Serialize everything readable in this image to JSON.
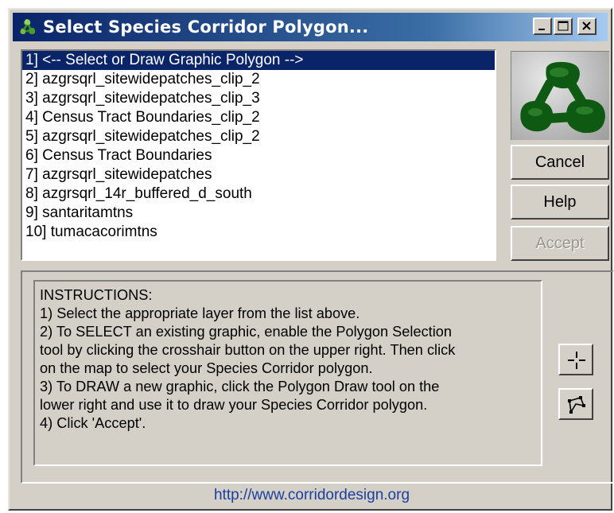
{
  "window": {
    "title": "Select Species Corridor Polygon...",
    "title_icon": "corridor-app-icon",
    "controls": [
      "minimize-icon",
      "maximize-icon",
      "close-icon"
    ]
  },
  "layer_list": {
    "items": [
      {
        "label": "1] <-- Select or Draw Graphic Polygon -->",
        "selected": true
      },
      {
        "label": "2] azgrsqrl_sitewidepatches_clip_2",
        "selected": false
      },
      {
        "label": "3] azgrsqrl_sitewidepatches_clip_3",
        "selected": false
      },
      {
        "label": "4] Census Tract Boundaries_clip_2",
        "selected": false
      },
      {
        "label": "5] azgrsqrl_sitewidepatches_clip_2",
        "selected": false
      },
      {
        "label": "6] Census Tract Boundaries",
        "selected": false
      },
      {
        "label": "7] azgrsqrl_sitewidepatches",
        "selected": false
      },
      {
        "label": "8] azgrsqrl_14r_buffered_d_south",
        "selected": false
      },
      {
        "label": "9] santaritamtns",
        "selected": false
      },
      {
        "label": "10] tumacacorimtns",
        "selected": false
      }
    ]
  },
  "buttons": {
    "cancel": "Cancel",
    "help": "Help",
    "accept": "Accept",
    "accept_enabled": false
  },
  "instructions": {
    "lines": [
      "INSTRUCTIONS:",
      "1) Select the appropriate layer from the list above.",
      "2) To SELECT an existing graphic, enable the Polygon Selection",
      "tool by clicking the crosshair button on the upper right.  Then click",
      "on the map to select your Species Corridor polygon.",
      "3) To DRAW a new graphic, click the Polygon Draw tool on the",
      "lower right and use it to draw your Species Corridor polygon.",
      "4) Click 'Accept'."
    ]
  },
  "tools": {
    "select_icon": "crosshair-icon",
    "draw_icon": "polygon-draw-icon"
  },
  "footer": {
    "link": "http://www.corridordesign.org"
  },
  "colors": {
    "title_bar_start": "#0a246a",
    "title_bar_end": "#a6caf0",
    "selection": "#0a246a",
    "dialog_face": "#d4d0c8",
    "link": "#1a3f9e",
    "logo_green": "#0f5a12"
  }
}
